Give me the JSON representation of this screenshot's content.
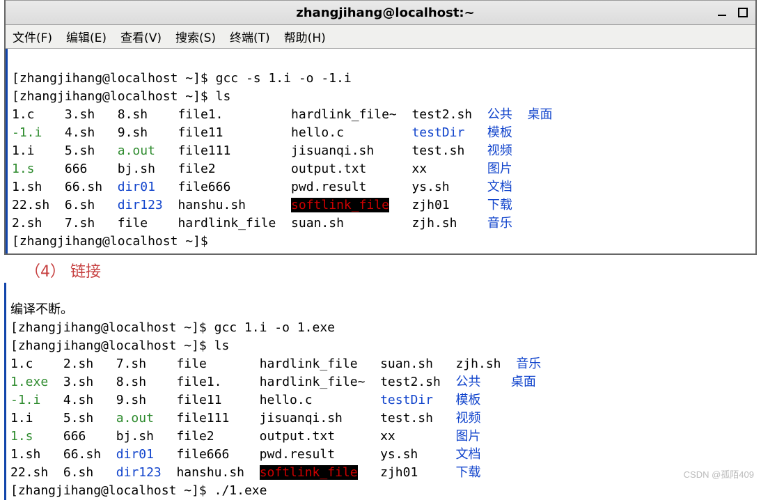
{
  "titlebar": {
    "title": "zhangjihang@localhost:~"
  },
  "menu": {
    "file": "文件(F)",
    "edit": "编辑(E)",
    "view": "查看(V)",
    "search": "搜索(S)",
    "terminal": "终端(T)",
    "help": "帮助(H)"
  },
  "term1": {
    "prompt1": "[zhangjihang@localhost ~]$ ",
    "cmd1": "gcc -s 1.i -o -1.i",
    "prompt2": "[zhangjihang@localhost ~]$ ",
    "cmd2": "ls",
    "ls": {
      "r0c0": "1.c",
      "r0c1": "3.sh",
      "r0c2": "8.sh",
      "r0c3": "file1.",
      "r0c4": "hardlink_file~",
      "r0c5": "test2.sh",
      "r0c6": "公共",
      "r0c7": "桌面",
      "r1c0": "-1.i",
      "r1c1": "4.sh",
      "r1c2": "9.sh",
      "r1c3": "file11",
      "r1c4": "hello.c",
      "r1c5": "testDir",
      "r1c6": "模板",
      "r2c0": "1.i",
      "r2c1": "5.sh",
      "r2c2": "a.out",
      "r2c3": "file111",
      "r2c4": "jisuanqi.sh",
      "r2c5": "test.sh",
      "r2c6": "视频",
      "r3c0": "1.s",
      "r3c1": "666",
      "r3c2": "bj.sh",
      "r3c3": "file2",
      "r3c4": "output.txt",
      "r3c5": "xx",
      "r3c6": "图片",
      "r4c0": "1.sh",
      "r4c1": "66.sh",
      "r4c2": "dir01",
      "r4c3": "file666",
      "r4c4": "pwd.result",
      "r4c5": "ys.sh",
      "r4c6": "文档",
      "r5c0": "22.sh",
      "r5c1": "6.sh",
      "r5c2": "dir123",
      "r5c3": "hanshu.sh",
      "r5c4": "softlink_file",
      "r5c5": "zjh01",
      "r5c6": "下载",
      "r6c0": "2.sh",
      "r6c1": "7.sh",
      "r6c2": "file",
      "r6c3": "hardlink_file",
      "r6c4": "suan.sh",
      "r6c5": "zjh.sh",
      "r6c6": "音乐"
    },
    "prompt3": "[zhangjihang@localhost ~]$ "
  },
  "section_label": "（4） 链接",
  "term2": {
    "toprow": "编译不断。",
    "prompt1": "[zhangjihang@localhost ~]$ ",
    "cmd1": "gcc 1.i -o 1.exe",
    "prompt2": "[zhangjihang@localhost ~]$ ",
    "cmd2": "ls",
    "ls": {
      "r0c0": "1.c",
      "r0c1": "2.sh",
      "r0c2": "7.sh",
      "r0c3": "file",
      "r0c4": "hardlink_file",
      "r0c5": "suan.sh",
      "r0c6": "zjh.sh",
      "r0c7": "音乐",
      "r1c0": "1.exe",
      "r1c1": "3.sh",
      "r1c2": "8.sh",
      "r1c3": "file1.",
      "r1c4": "hardlink_file~",
      "r1c5": "test2.sh",
      "r1c6": "公共",
      "r1c7": "桌面",
      "r2c0": "-1.i",
      "r2c1": "4.sh",
      "r2c2": "9.sh",
      "r2c3": "file11",
      "r2c4": "hello.c",
      "r2c5": "testDir",
      "r2c6": "模板",
      "r3c0": "1.i",
      "r3c1": "5.sh",
      "r3c2": "a.out",
      "r3c3": "file111",
      "r3c4": "jisuanqi.sh",
      "r3c5": "test.sh",
      "r3c6": "视频",
      "r4c0": "1.s",
      "r4c1": "666",
      "r4c2": "bj.sh",
      "r4c3": "file2",
      "r4c4": "output.txt",
      "r4c5": "xx",
      "r4c6": "图片",
      "r5c0": "1.sh",
      "r5c1": "66.sh",
      "r5c2": "dir01",
      "r5c3": "file666",
      "r5c4": "pwd.result",
      "r5c5": "ys.sh",
      "r5c6": "文档",
      "r6c0": "22.sh",
      "r6c1": "6.sh",
      "r6c2": "dir123",
      "r6c3": "hanshu.sh",
      "r6c4": "softlink_file",
      "r6c5": "zjh01",
      "r6c6": "下载"
    },
    "prompt3": "[zhangjihang@localhost ~]$ ",
    "cmd3": "./1.exe"
  },
  "watermark": "CSDN @孤陌409"
}
